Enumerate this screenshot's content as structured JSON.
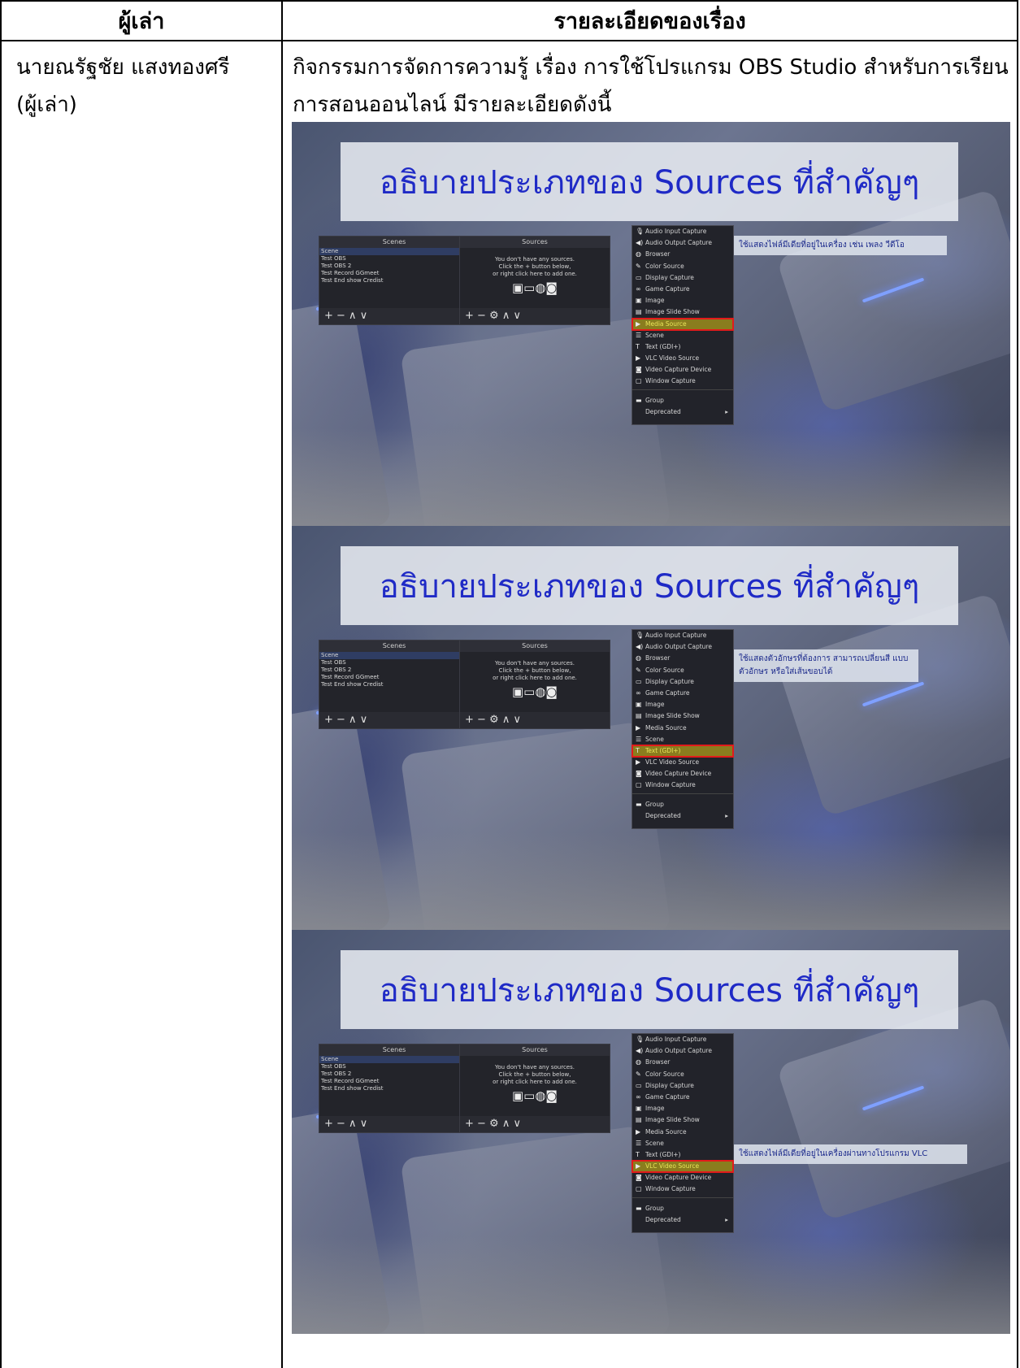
{
  "table": {
    "header_narrator": "ผู้เล่า",
    "header_details": "รายละเอียดของเรื่อง"
  },
  "narrator": {
    "name": "นายณรัฐชัย  แสงทองศรี",
    "role": "(ผู้เล่า)"
  },
  "intro": {
    "line1": "กิจกรรมการจัดการความรู้ เรื่อง การใช้โปรแกรม OBS Studio สำหรับการเรียน",
    "line2": "การสอนออนไลน์ มีรายละเอียดดังนี้"
  },
  "slides": [
    {
      "title": "อธิบายประเภทของ Sources ที่สำคัญๆ",
      "highlight": "Media Source",
      "callout": "ใช้แสดงไฟล์มีเดียที่อยู่ในเครื่อง เช่น เพลง วีดีโอ"
    },
    {
      "title": "อธิบายประเภทของ Sources ที่สำคัญๆ",
      "highlight": "Text (GDI+)",
      "callout": "ใช้แสดงตัวอักษรที่ต้องการ สามารถเปลี่ยนสี แบบตัวอักษร หรือใส่เส้นขอบได้"
    },
    {
      "title": "อธิบายประเภทของ Sources ที่สำคัญๆ",
      "highlight": "VLC Video Source",
      "callout": "ใช้แสดงไฟล์มีเดียที่อยู่ในเครื่องผ่านทางโปรแกรม VLC"
    }
  ],
  "obs": {
    "scenes_header": "Scenes",
    "sources_header": "Sources",
    "scenes": [
      "Scene",
      "Test OBS",
      "Test OBS 2",
      "Test Record GGmeet",
      "Test End show Credist"
    ],
    "empty_line1": "You don't have any sources.",
    "empty_line2": "Click the + button below,",
    "empty_line3": "or right click here to add one.",
    "scenes_footer": "+ −  ∧ ∨",
    "sources_footer": "+ − ⚙ ∧ ∨",
    "menu_items": [
      {
        "label": "Audio Input Capture",
        "icon": "microphone-icon",
        "glyph": "🎙"
      },
      {
        "label": "Audio Output Capture",
        "icon": "speaker-icon",
        "glyph": "◀)"
      },
      {
        "label": "Browser",
        "icon": "globe-icon",
        "glyph": "◍"
      },
      {
        "label": "Color Source",
        "icon": "brush-icon",
        "glyph": "✎"
      },
      {
        "label": "Display Capture",
        "icon": "monitor-icon",
        "glyph": "▭"
      },
      {
        "label": "Game Capture",
        "icon": "gamepad-icon",
        "glyph": "∞"
      },
      {
        "label": "Image",
        "icon": "image-icon",
        "glyph": "▣"
      },
      {
        "label": "Image Slide Show",
        "icon": "slideshow-icon",
        "glyph": "▤"
      },
      {
        "label": "Media Source",
        "icon": "play-icon",
        "glyph": "▶"
      },
      {
        "label": "Scene",
        "icon": "list-icon",
        "glyph": "☰"
      },
      {
        "label": "Text (GDI+)",
        "icon": "text-icon",
        "glyph": "T"
      },
      {
        "label": "VLC Video Source",
        "icon": "play-icon",
        "glyph": "▶"
      },
      {
        "label": "Video Capture Device",
        "icon": "camera-icon",
        "glyph": "◙"
      },
      {
        "label": "Window Capture",
        "icon": "window-icon",
        "glyph": "▢"
      }
    ],
    "group_label": "Group",
    "deprecated_label": "Deprecated"
  }
}
